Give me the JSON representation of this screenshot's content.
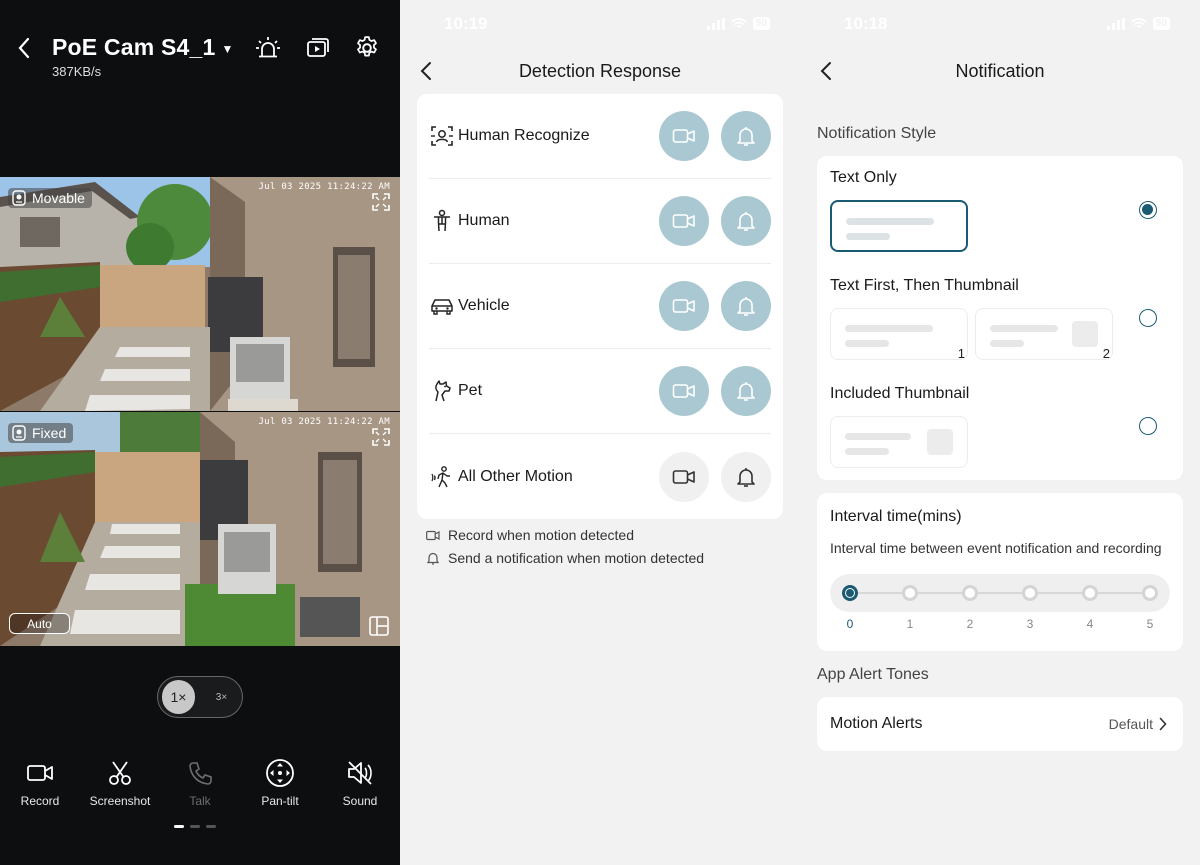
{
  "camera": {
    "title": "PoE Cam S4_1",
    "bitrate": "387KB/s",
    "feeds": [
      {
        "mode": "Movable",
        "timestamp": "Jul 03 2025  11:24:22 AM"
      },
      {
        "mode": "Fixed",
        "timestamp": "Jul 03 2025  11:24:22 AM",
        "auto_label": "Auto"
      }
    ],
    "zoom": {
      "options": [
        "1×",
        "3×"
      ],
      "selected": "1×"
    },
    "toolbar": [
      {
        "label": "Record",
        "icon": "video-camera-icon"
      },
      {
        "label": "Screenshot",
        "icon": "scissors-icon"
      },
      {
        "label": "Talk",
        "icon": "phone-icon",
        "disabled": true
      },
      {
        "label": "Pan-tilt",
        "icon": "pan-tilt-icon"
      },
      {
        "label": "Sound",
        "icon": "speaker-muted-icon"
      }
    ],
    "page_dots": 3,
    "active_page": 0
  },
  "detection": {
    "status_time": "10:19",
    "battery": "90",
    "title": "Detection Response",
    "rows": [
      {
        "label": "Human Recognize",
        "icon": "face-scan-icon",
        "record": true,
        "notify": true
      },
      {
        "label": "Human",
        "icon": "person-icon",
        "record": true,
        "notify": true
      },
      {
        "label": "Vehicle",
        "icon": "car-icon",
        "record": true,
        "notify": true
      },
      {
        "label": "Pet",
        "icon": "pet-icon",
        "record": true,
        "notify": true
      },
      {
        "label": "All Other Motion",
        "icon": "motion-icon",
        "record": false,
        "notify": false
      }
    ],
    "legend_record": "Record when motion detected",
    "legend_notify": "Send a notification when motion detected"
  },
  "notification": {
    "status_time": "10:18",
    "battery": "90",
    "title": "Notification",
    "style_section": "Notification Style",
    "styles": [
      {
        "label": "Text Only",
        "selected": true
      },
      {
        "label": "Text First, Then Thumbnail",
        "selected": false,
        "steps": [
          "1",
          "2"
        ]
      },
      {
        "label": "Included Thumbnail",
        "selected": false
      }
    ],
    "interval_title": "Interval time(mins)",
    "interval_desc": "Interval time between event notification and recording",
    "interval_options": [
      "0",
      "1",
      "2",
      "3",
      "4",
      "5"
    ],
    "interval_selected": "0",
    "tones_section": "App Alert Tones",
    "motion_alerts_label": "Motion Alerts",
    "motion_alerts_value": "Default"
  },
  "colors": {
    "accent": "#1b5a73",
    "toggle_on": "#a9c8d2",
    "toggle_off": "#f0f0f0",
    "camera_bg": "#0d0e10",
    "settings_bg": "#f2f2f2"
  }
}
